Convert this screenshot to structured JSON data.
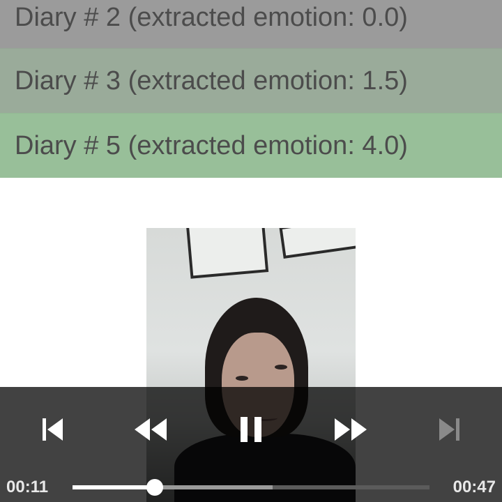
{
  "diary_list": {
    "items": [
      {
        "label": "Diary # 2 (extracted emotion: 0.0)",
        "color": "#9b9b9b"
      },
      {
        "label": "Diary # 3 (extracted emotion: 1.5)",
        "color": "#9aab9a"
      },
      {
        "label": "Diary # 5 (extracted emotion: 4.0)",
        "color": "#98bf99"
      }
    ]
  },
  "player": {
    "current_time": "00:11",
    "total_time": "00:47",
    "progress_fraction": 0.23,
    "buffered_fraction": 0.56,
    "icons": {
      "previous": "skip-previous-icon",
      "rewind": "rewind-icon",
      "pause": "pause-icon",
      "fast_forward": "fast-forward-icon",
      "next": "skip-next-icon"
    },
    "next_enabled": false
  }
}
